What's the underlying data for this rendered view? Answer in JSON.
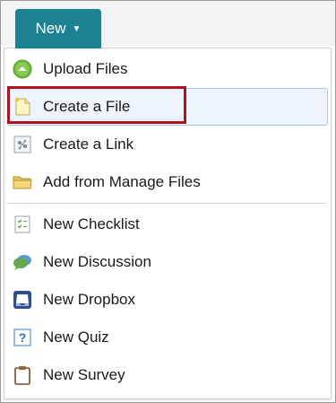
{
  "toolbar": {
    "new_label": "New",
    "caret_glyph": "▼"
  },
  "menu": {
    "items": [
      {
        "label": "Upload Files",
        "icon": "upload-icon"
      },
      {
        "label": "Create a File",
        "icon": "document-icon"
      },
      {
        "label": "Create a Link",
        "icon": "link-icon"
      },
      {
        "label": "Add from Manage Files",
        "icon": "folder-icon"
      },
      {
        "label": "New Checklist",
        "icon": "checklist-icon"
      },
      {
        "label": "New Discussion",
        "icon": "discussion-icon"
      },
      {
        "label": "New Dropbox",
        "icon": "dropbox-icon"
      },
      {
        "label": "New Quiz",
        "icon": "quiz-icon"
      },
      {
        "label": "New Survey",
        "icon": "survey-icon"
      }
    ]
  },
  "colors": {
    "button": "#1c8191",
    "hover_background": "#eef4fd",
    "hover_border": "#a6c4ea",
    "highlight": "#b1111d"
  }
}
